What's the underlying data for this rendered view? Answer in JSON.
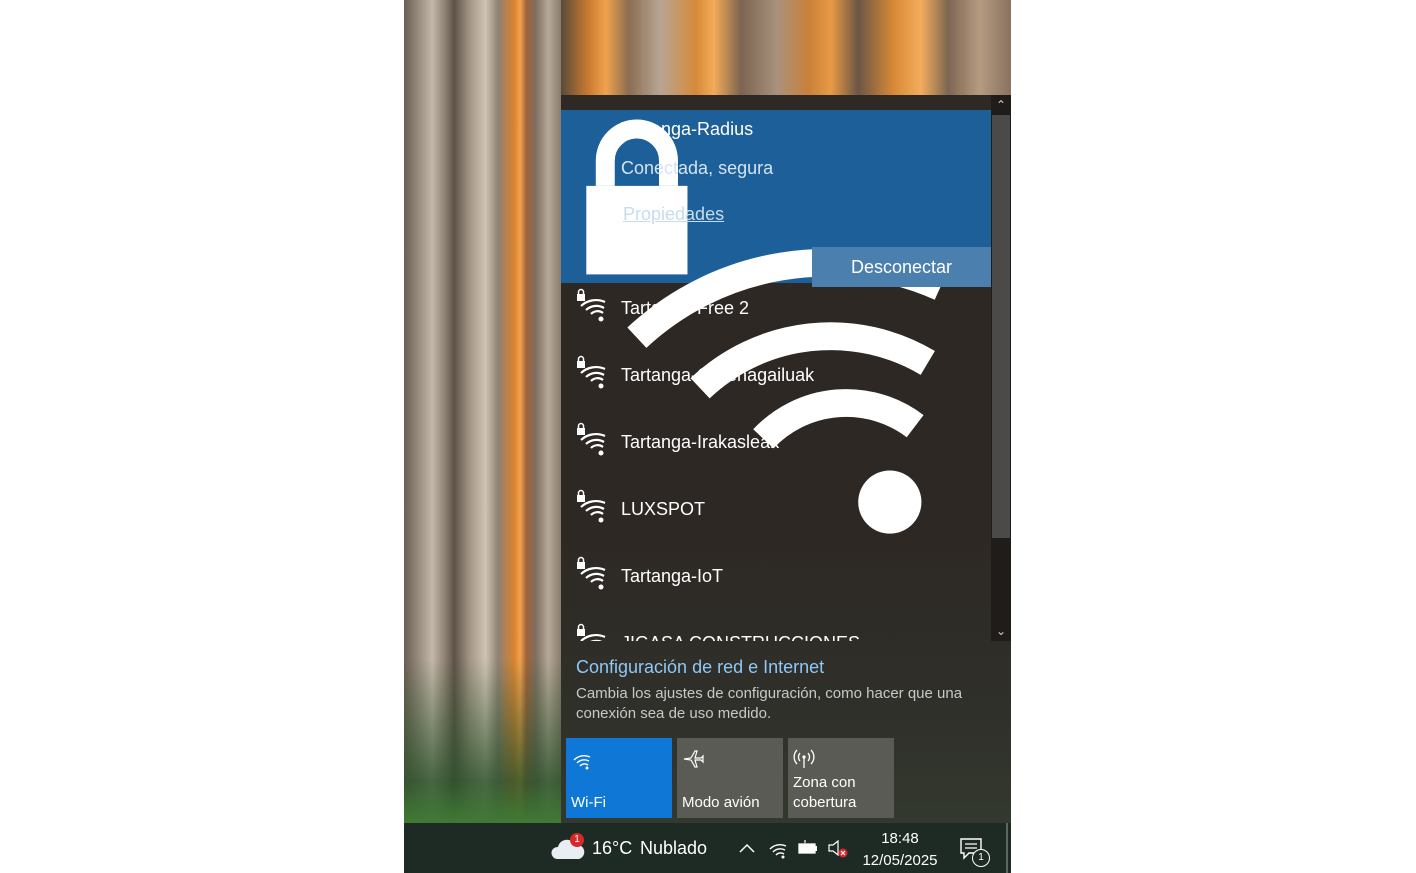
{
  "networks": {
    "connected": {
      "name": "Tartanga-Radius",
      "status": "Conectada, segura",
      "properties_label": "Propiedades",
      "disconnect_label": "Desconectar"
    },
    "others": [
      {
        "name": "Tartanga-Free 2"
      },
      {
        "name": "Tartanga-Ordenagailuak"
      },
      {
        "name": "Tartanga-Irakasleak"
      },
      {
        "name": "LUXSPOT"
      },
      {
        "name": "Tartanga-IoT"
      },
      {
        "name": "JIGASA CONSTRUCCIONES"
      }
    ],
    "icons": {
      "network": "wifi-secured-icon"
    }
  },
  "settings": {
    "link": "Configuración de red e Internet",
    "description": "Cambia los ajustes de configuración, como hacer que una conexión sea de uso medido."
  },
  "quick_actions": {
    "wifi": {
      "label": "Wi-Fi",
      "icon": "wifi-icon",
      "active": true
    },
    "airplane": {
      "label": "Modo avión",
      "icon": "airplane-icon",
      "active": false
    },
    "hotspot": {
      "label": "Zona con cobertura",
      "icon": "hotspot-icon",
      "active": false
    }
  },
  "taskbar": {
    "weather": {
      "temp": "16°C",
      "condition": "Nublado",
      "badge": "1"
    },
    "time": "18:48",
    "date": "12/05/2025",
    "notifications_count": "1"
  },
  "colors": {
    "connected_bg": "#1c5f99",
    "accent": "#0f78d7",
    "link": "#8fc8f5"
  }
}
